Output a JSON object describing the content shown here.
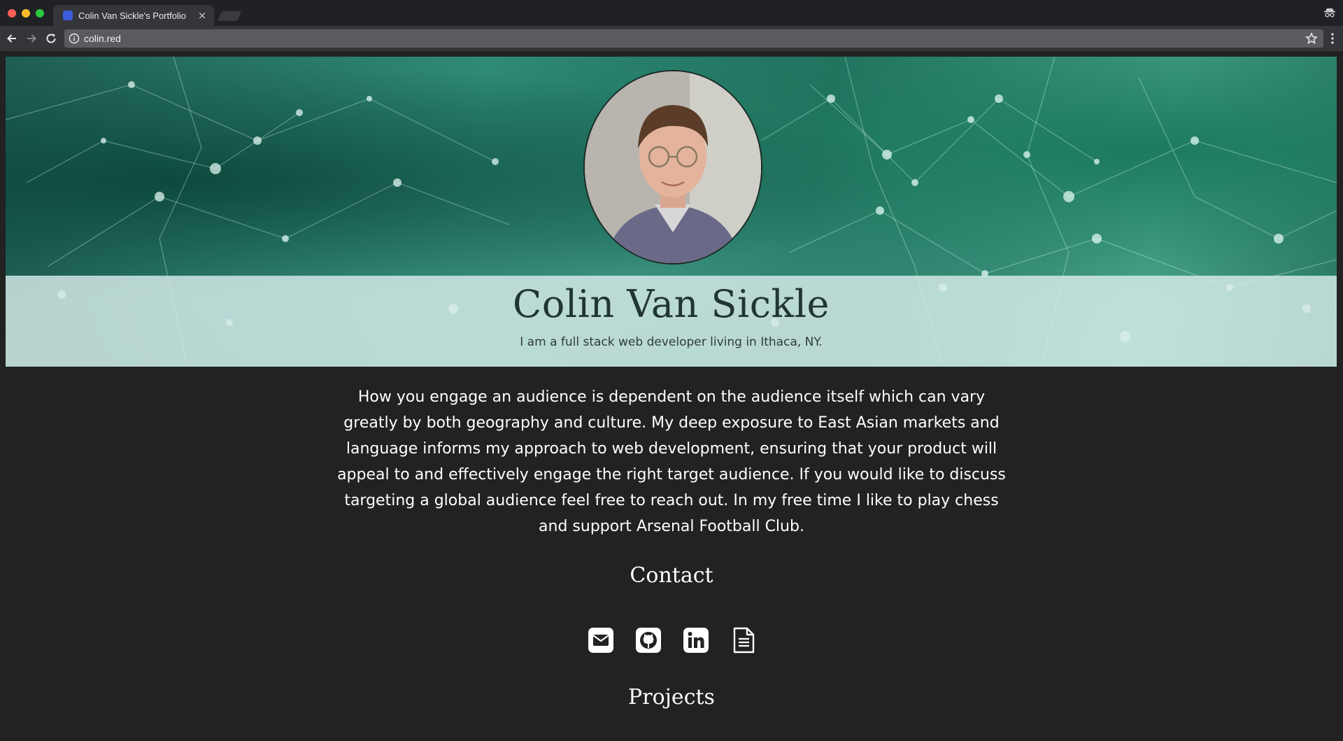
{
  "browser": {
    "tab_title": "Colin Van Sickle's Portfolio",
    "tab_close": "×",
    "url": "colin.red"
  },
  "hero": {
    "name": "Colin Van Sickle",
    "tagline": "I am a full stack web developer living in Ithaca, NY."
  },
  "bio": "How you engage an audience is dependent on the audience itself which can vary greatly by both geography and culture. My deep exposure to East Asian markets and language informs my approach to web development, ensuring that your product will appeal to and effectively engage the right target audience. If you would like to discuss targeting a global audience feel free to reach out. In my free time I like to play chess and support Arsenal Football Club.",
  "contact": {
    "heading": "Contact",
    "links": [
      {
        "icon": "envelope-icon"
      },
      {
        "icon": "github-icon"
      },
      {
        "icon": "linkedin-icon"
      },
      {
        "icon": "document-icon"
      }
    ]
  },
  "projects": {
    "heading": "Projects"
  },
  "colors": {
    "page_background": "#222222",
    "hero_band": "#d8ecea",
    "name_text": "#213532",
    "body_text": "#ffffff"
  }
}
